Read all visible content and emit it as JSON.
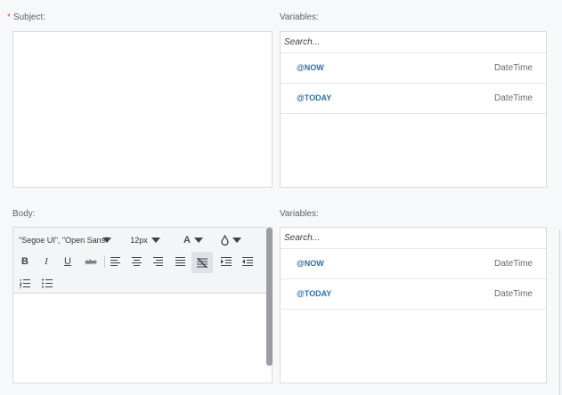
{
  "subject": {
    "required_mark": "*",
    "label": "Subject:"
  },
  "body": {
    "label": "Body:",
    "font_family": "\"Segoe UI\", \"Open Sans\"",
    "font_size": "12px",
    "text_color_label": "A",
    "strikethrough_label": "abc"
  },
  "variables_top": {
    "label": "Variables:",
    "search_placeholder": "Search...",
    "items": [
      {
        "name": "@NOW",
        "type": "DateTime"
      },
      {
        "name": "@TODAY",
        "type": "DateTime"
      }
    ]
  },
  "variables_bottom": {
    "label": "Variables:",
    "search_placeholder": "Search...",
    "items": [
      {
        "name": "@NOW",
        "type": "DateTime"
      },
      {
        "name": "@TODAY",
        "type": "DateTime"
      }
    ]
  },
  "colors": {
    "accent": "#2f6fa0",
    "required": "#d9534f",
    "border": "#d9dcdf",
    "toolbar_bg": "#f3f5f6"
  }
}
